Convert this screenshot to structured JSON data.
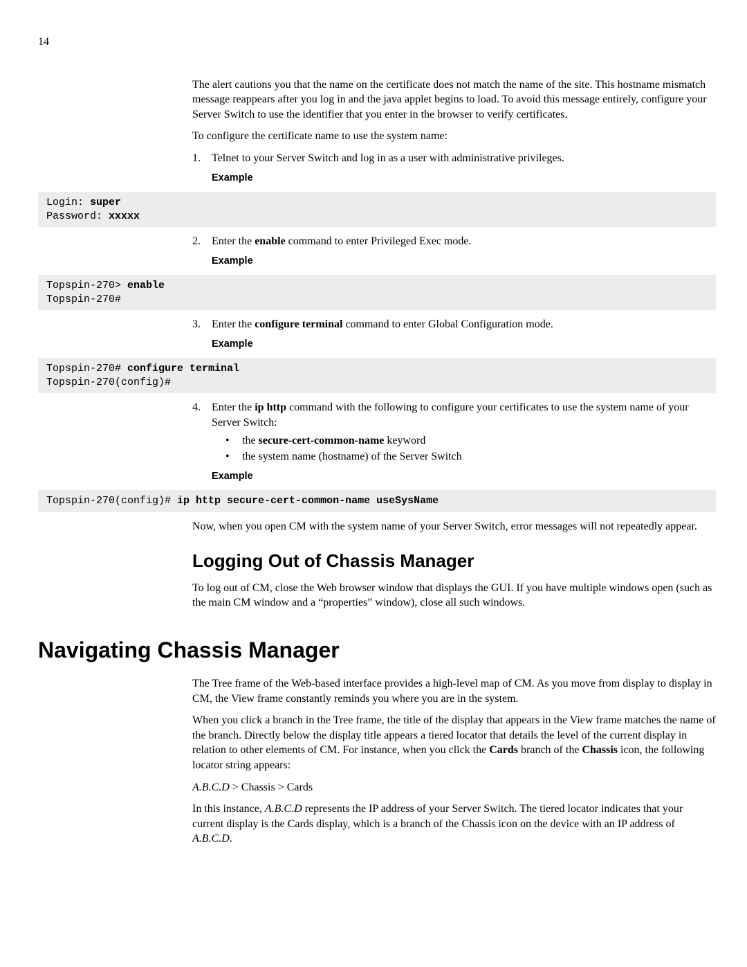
{
  "page_number": "14",
  "intro_paragraph": "The alert cautions you that the name on the certificate does not match the name of the site. This hostname mismatch message reappears after you log in and the java applet begins to load. To avoid this message entirely, configure your Server Switch to use the identifier that you enter in the browser to verify certificates.",
  "configure_line": "To configure the certificate name to use the system name:",
  "step1": {
    "num": "1.",
    "text": "Telnet to your Server Switch and log in as a user with administrative privileges.",
    "example_label": "Example",
    "code_prompt1": "Login: ",
    "code_bold1": "super",
    "code_prompt2": "Password: ",
    "code_bold2": "xxxxx"
  },
  "step2": {
    "num": "2.",
    "pre": "Enter the ",
    "bold": "enable",
    "post": " command to enter Privileged Exec mode.",
    "example_label": "Example",
    "code_line1_pre": "Topspin-270> ",
    "code_line1_bold": "enable",
    "code_line2": "Topspin-270#"
  },
  "step3": {
    "num": "3.",
    "pre": "Enter the ",
    "bold": "configure terminal",
    "post": " command to enter Global Configuration mode.",
    "example_label": "Example",
    "code_line1_pre": "Topspin-270# ",
    "code_line1_bold": "configure terminal",
    "code_line2": "Topspin-270(config)#"
  },
  "step4": {
    "num": "4.",
    "pre": "Enter the ",
    "bold": "ip http",
    "post": " command with the following to configure your certificates to use the system name of your Server Switch:",
    "bullet1_pre": "the ",
    "bullet1_bold": "secure-cert-common-name",
    "bullet1_post": " keyword",
    "bullet2": "the system name (hostname) of the Server Switch",
    "example_label": "Example",
    "code_pre": "Topspin-270(config)# ",
    "code_bold": "ip http secure-cert-common-name useSysName"
  },
  "closing_paragraph": "Now, when you open CM with the system name of your Server Switch, error messages will not repeatedly appear.",
  "logout_heading": "Logging Out of Chassis Manager",
  "logout_paragraph": "To log out of CM, close the Web browser window that displays the GUI. If you have multiple windows open (such as the main CM window and a “properties” window), close all such windows.",
  "nav_heading": "Navigating Chassis Manager",
  "nav_p1": "The Tree frame of the Web-based interface provides a high-level map of CM. As you move from display to display in CM, the View frame constantly reminds you where you are in the system.",
  "nav_p2_part1": "When you click a branch in the Tree frame, the title of the display that appears in the View frame matches the name of the branch. Directly below the display title appears a tiered locator that details the level of the current display in relation to other elements of CM. For instance, when you click the ",
  "nav_p2_bold1": "Cards",
  "nav_p2_part2": " branch of the ",
  "nav_p2_bold2": "Chassis",
  "nav_p2_part3": " icon, the following locator string appears:",
  "locator_italic": "A.B.C.D",
  "locator_rest": " > Chassis > Cards",
  "nav_p3_part1": "In this instance, ",
  "nav_p3_italic1": "A.B.C.D",
  "nav_p3_part2": " represents the IP address of your Server Switch. The tiered locator indicates that your current display is the Cards display, which is a branch of the Chassis icon on the device with an IP address of ",
  "nav_p3_italic2": "A.B.C.D",
  "nav_p3_part3": "."
}
